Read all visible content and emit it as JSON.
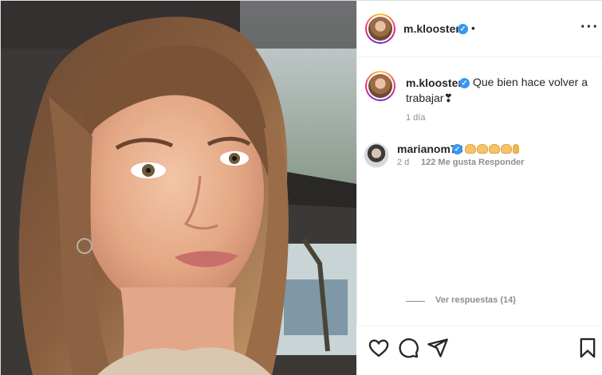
{
  "post": {
    "username": "m.klooster",
    "header_separator": "•",
    "more_icon": "more-dots-icon"
  },
  "caption": {
    "username": "m.klooster",
    "text_line1": "Que bien hace volver a",
    "text_line2": "trabajar",
    "emoji": "❣",
    "time": "1 día"
  },
  "comments": [
    {
      "username": "marianom78",
      "emojis": [
        "clap",
        "clap",
        "clap",
        "clap",
        "clap"
      ],
      "time": "2 d",
      "likes": "122 Me gusta",
      "reply_label": "Responder"
    }
  ],
  "replies_label": "Ver respuestas (14)",
  "actions": {
    "like_icon": "heart-icon",
    "comment_icon": "comment-icon",
    "share_icon": "share-icon",
    "save_icon": "bookmark-icon"
  },
  "colors": {
    "verified": "#3897f0",
    "text": "#262626",
    "muted": "#8e8e8e",
    "border": "#efefef"
  }
}
